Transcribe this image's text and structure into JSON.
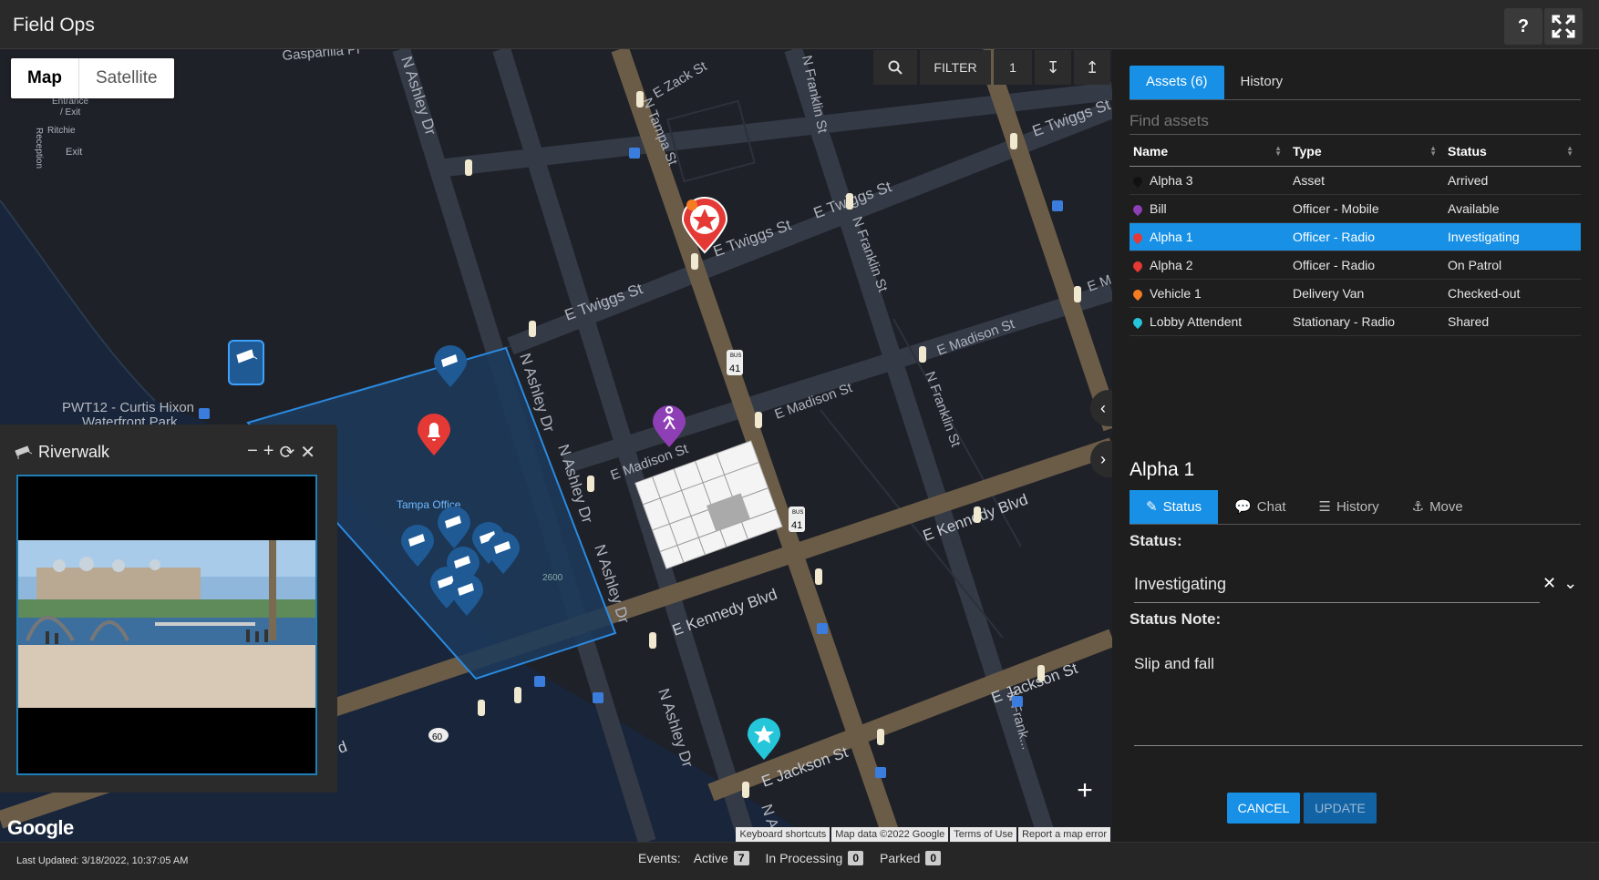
{
  "app": {
    "title": "Field Ops"
  },
  "titlebar": {
    "help_label": "?",
    "fullscreen_icon": "fullscreen-icon"
  },
  "map": {
    "map_type": {
      "map_label": "Map",
      "satellite_label": "Satellite",
      "selected": "Map"
    },
    "toolbar": {
      "filter_label": "FILTER",
      "filter_count": "1"
    },
    "labels": {
      "gasparilla": "Gasparilla Pl",
      "entrance": "Entrance",
      "exit_slash": "/ Exit",
      "ritchie": "Ritchie",
      "reception": "Reception",
      "exit": "Exit",
      "e_zack": "E Zack St",
      "n_tampa": "N Tampa St",
      "n_franklin_1": "N Franklin St",
      "n_franklin_2": "N Franklin St",
      "n_franklin_3": "N Franklin St",
      "n_franklin_4": "N Frank...",
      "e_twiggs_1": "E Twiggs St",
      "e_twiggs_2": "E Twiggs St",
      "e_twiggs_3": "E Twiggs St",
      "e_twiggs_4": "E Twiggs St",
      "n_ashley_1": "N Ashley Dr",
      "n_ashley_2": "N Ashley Dr",
      "n_ashley_3": "N Ashley Dr",
      "n_ashley_4": "N Ashley Dr",
      "n_ashley_5": "N Ashley Dr",
      "n_ashley_6": "N A...",
      "e_madison_1": "E Madison St",
      "e_madison_2": "E Madison St",
      "e_madison_3": "E Madison St",
      "e_m": "E M",
      "e_kennedy_1": "E Kennedy Blvd",
      "e_kennedy_2": "E Kennedy Blvd",
      "e_jackson_1": "E Jackson St",
      "e_jackson_2": "E Jackson St",
      "pwt12": "PWT12 - Curtis Hixon",
      "waterfront": "Waterfront Park",
      "tampa_office": "Tampa Office",
      "num_2600": "2600",
      "shield_41": "41",
      "shield_bus": "BUS",
      "shield_60": "60",
      "kennedy_partial": "vd"
    },
    "zoom": {
      "in_label": "+",
      "out_label": "−"
    },
    "attribution": [
      "Keyboard shortcuts",
      "Map data ©2022 Google",
      "Terms of Use",
      "Report a map error"
    ],
    "google_logo": "Google"
  },
  "video": {
    "title": "Riverwalk",
    "controls": [
      "−",
      "+",
      "⟳",
      "✕"
    ]
  },
  "panel": {
    "tabs": [
      {
        "label": "Assets (6)",
        "active": true
      },
      {
        "label": "History",
        "active": false
      }
    ],
    "search": {
      "placeholder": "Find assets"
    },
    "columns": [
      "Name",
      "Type",
      "Status"
    ],
    "assets": [
      {
        "name": "Alpha 3",
        "type": "Asset",
        "status": "Arrived",
        "color": "#111111",
        "selected": false
      },
      {
        "name": "Bill",
        "type": "Officer - Mobile",
        "status": "Available",
        "color": "#8e3fb5",
        "selected": false
      },
      {
        "name": "Alpha 1",
        "type": "Officer - Radio",
        "status": "Investigating",
        "color": "#e53935",
        "selected": true
      },
      {
        "name": "Alpha 2",
        "type": "Officer - Radio",
        "status": "On Patrol",
        "color": "#e53935",
        "selected": false
      },
      {
        "name": "Vehicle 1",
        "type": "Delivery Van",
        "status": "Checked-out",
        "color": "#f57c20",
        "selected": false
      },
      {
        "name": "Lobby Attendent",
        "type": "Stationary - Radio",
        "status": "Shared",
        "color": "#26c6da",
        "selected": false
      }
    ],
    "detail": {
      "title": "Alpha 1",
      "tabs": [
        {
          "label": "Status",
          "icon": "edit-icon",
          "active": true
        },
        {
          "label": "Chat",
          "icon": "chat-icon",
          "active": false
        },
        {
          "label": "History",
          "icon": "list-icon",
          "active": false
        },
        {
          "label": "Move",
          "icon": "move-icon",
          "active": false
        }
      ],
      "status_label": "Status:",
      "status_value": "Investigating",
      "note_label": "Status Note:",
      "note_value": "Slip and fall",
      "cancel_label": "CANCEL",
      "update_label": "UPDATE"
    }
  },
  "statusbar": {
    "last_updated": "Last Updated: 3/18/2022, 10:37:05 AM",
    "events_label": "Events:",
    "active_label": "Active",
    "active_count": "7",
    "processing_label": "In Processing",
    "processing_count": "0",
    "parked_label": "Parked",
    "parked_count": "0"
  },
  "colors": {
    "accent": "#1790e6",
    "alert": "#e53935",
    "marker_blue": "#1f6fae",
    "road": "#7a6a55"
  }
}
